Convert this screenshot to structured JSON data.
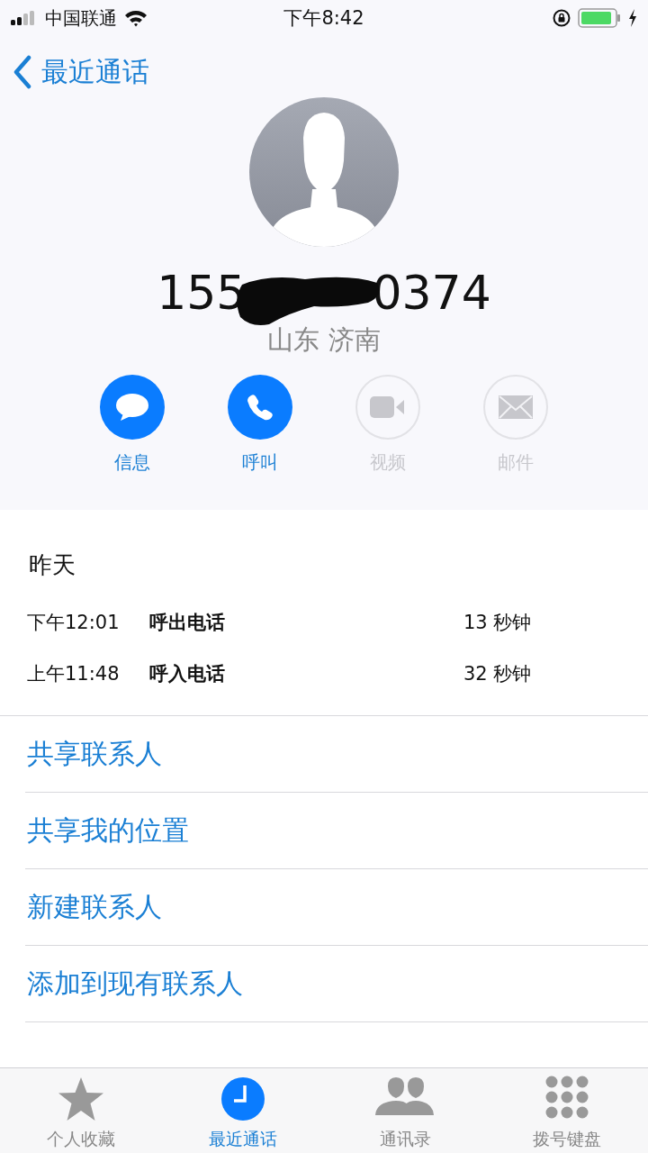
{
  "status_bar": {
    "carrier": "中国联通",
    "time": "下午8:42"
  },
  "nav": {
    "back_label": "最近通话"
  },
  "contact": {
    "number_start": "155",
    "number_end": "0374",
    "redacted": true,
    "location": "山东 济南"
  },
  "actions": [
    {
      "kind": "message",
      "label": "信息",
      "disabled": false
    },
    {
      "kind": "call",
      "label": "呼叫",
      "disabled": false
    },
    {
      "kind": "video",
      "label": "视频",
      "disabled": true
    },
    {
      "kind": "mail",
      "label": "邮件",
      "disabled": true
    }
  ],
  "history": {
    "day": "昨天",
    "calls": [
      {
        "time": "下午12:01",
        "type": "呼出电话",
        "duration": "13 秒钟"
      },
      {
        "time": "上午11:48",
        "type": "呼入电话",
        "duration": "32 秒钟"
      }
    ]
  },
  "options": [
    "共享联系人",
    "共享我的位置",
    "新建联系人",
    "添加到现有联系人"
  ],
  "tabs": [
    {
      "kind": "favorites",
      "label": "个人收藏",
      "selected": false
    },
    {
      "kind": "recents",
      "label": "最近通话",
      "selected": true
    },
    {
      "kind": "contacts",
      "label": "通讯录",
      "selected": false
    },
    {
      "kind": "keypad",
      "label": "拨号键盘",
      "selected": false
    }
  ]
}
